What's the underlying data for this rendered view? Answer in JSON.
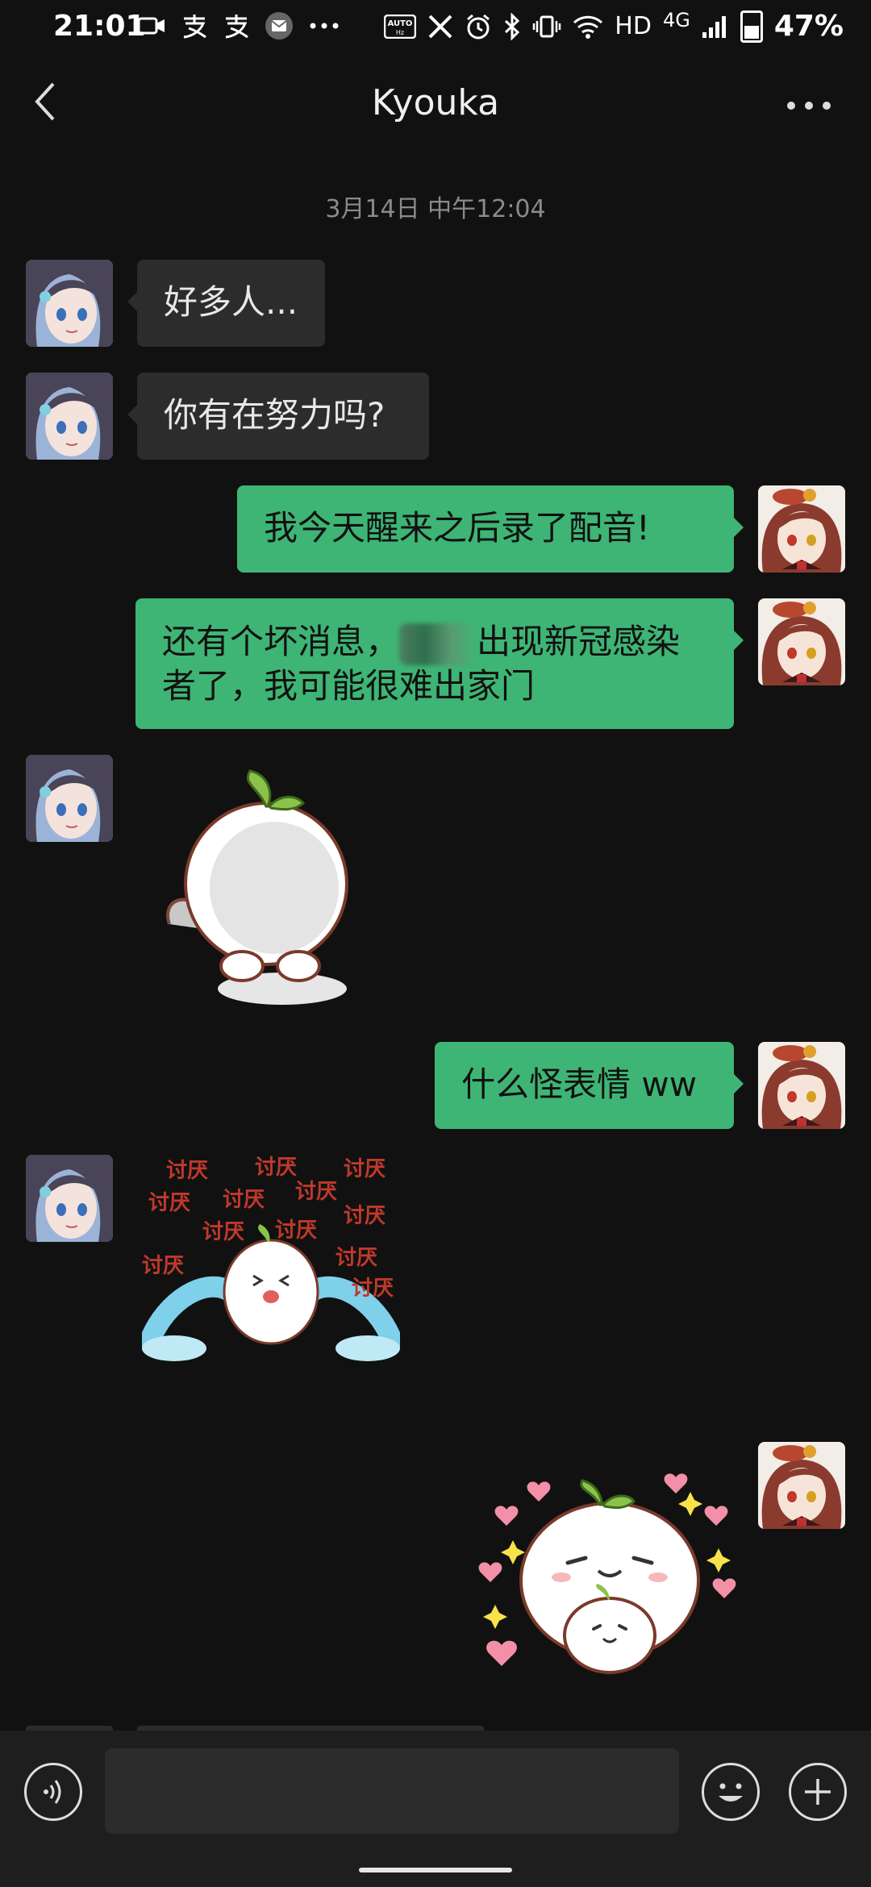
{
  "status_bar": {
    "time": "21:01",
    "left_icons": [
      "video-icon",
      "alipay-icon",
      "alipay-icon",
      "mail-icon",
      "more-dots-icon"
    ],
    "right_icons": [
      "auto-hz-icon",
      "x-icon",
      "alarm-icon",
      "bluetooth-icon",
      "vibrate-icon",
      "wifi-icon"
    ],
    "hd": "HD",
    "network": "4G",
    "battery_pct": "47%"
  },
  "header": {
    "title": "Kyouka"
  },
  "chat": {
    "timestamp": "3月14日 中午12:04",
    "messages": [
      {
        "from": "other",
        "type": "text",
        "text": "好多人..."
      },
      {
        "from": "other",
        "type": "text",
        "text": "你有在努力吗?"
      },
      {
        "from": "self",
        "type": "text",
        "text": "我今天醒来之后录了配音!"
      },
      {
        "from": "self",
        "type": "text",
        "line1_pre": "还有个坏消息，",
        "line1_post": "出现新冠感染",
        "line2": "者了，我可能很难出家门"
      },
      {
        "from": "other",
        "type": "sticker",
        "sticker": "peach-with-ladle-sticker"
      },
      {
        "from": "self",
        "type": "text",
        "text": "什么怪表情 ww"
      },
      {
        "from": "other",
        "type": "sticker",
        "sticker": "crying-hate-sticker",
        "sticker_text": "讨厌"
      },
      {
        "from": "self",
        "type": "sticker",
        "sticker": "happy-hearts-sticker"
      }
    ]
  },
  "colors": {
    "background": "#111111",
    "bubble_in": "#2c2c2c",
    "bubble_out": "#3eb575",
    "input_bar": "#1e1e1e"
  }
}
